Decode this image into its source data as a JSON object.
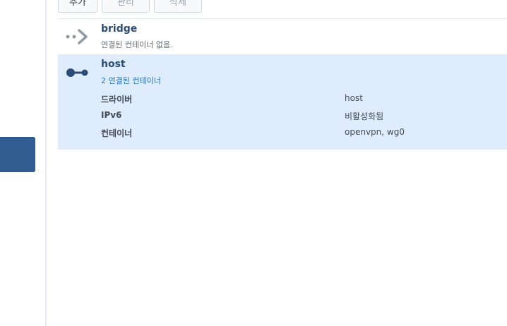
{
  "toolbar": {
    "add_label": "추가",
    "manage_label": "관리",
    "delete_label": "삭제"
  },
  "networks": {
    "bridge": {
      "name": "bridge",
      "status": "연결된 컨테이너 없음.",
      "icon": "arrow-dots-icon"
    },
    "host": {
      "name": "host",
      "status": "2 연결된 컨테이너",
      "icon": "connected-node-icon",
      "properties": {
        "driver_label": "드라이버",
        "driver_value": "host",
        "ipv6_label": "IPv6",
        "ipv6_value": "비활성화됨",
        "containers_label": "컨테이너",
        "containers_value": "openvpn, wg0"
      }
    }
  },
  "colors": {
    "accent": "#2f5d91",
    "selected_row": "#dfecfb",
    "link": "#1a73c8",
    "title": "#2a4d78"
  }
}
